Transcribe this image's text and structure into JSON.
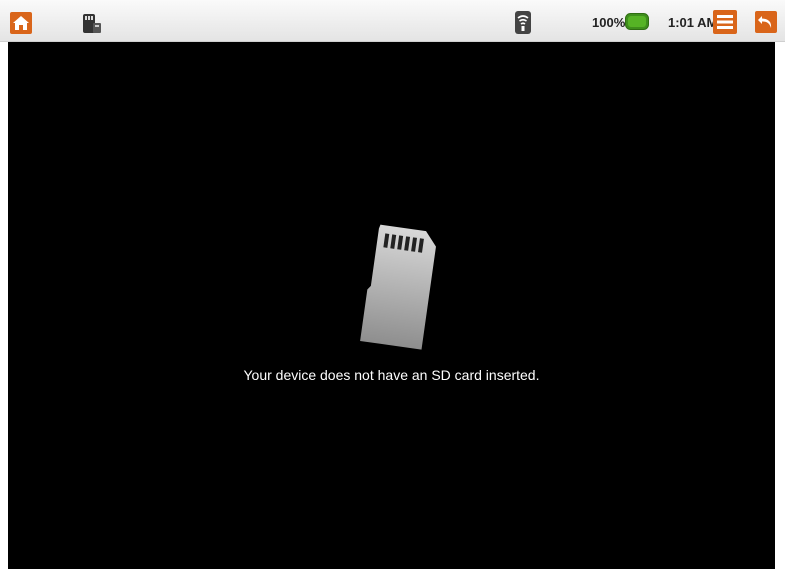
{
  "status_bar": {
    "battery_percent": "100%",
    "battery_level": 1.0,
    "clock": "1:01 AM",
    "icons": [
      "home-icon",
      "usb-icon",
      "wifi-icon",
      "battery-icon",
      "menu-icon",
      "back-icon"
    ],
    "colors": {
      "accent_orange": "#d9651a",
      "battery_green": "#56b325",
      "bar_background": "#ececec"
    }
  },
  "main": {
    "icon": "sdcard-icon",
    "message": "Your device does not have an SD card inserted.",
    "background_color": "#000000"
  }
}
